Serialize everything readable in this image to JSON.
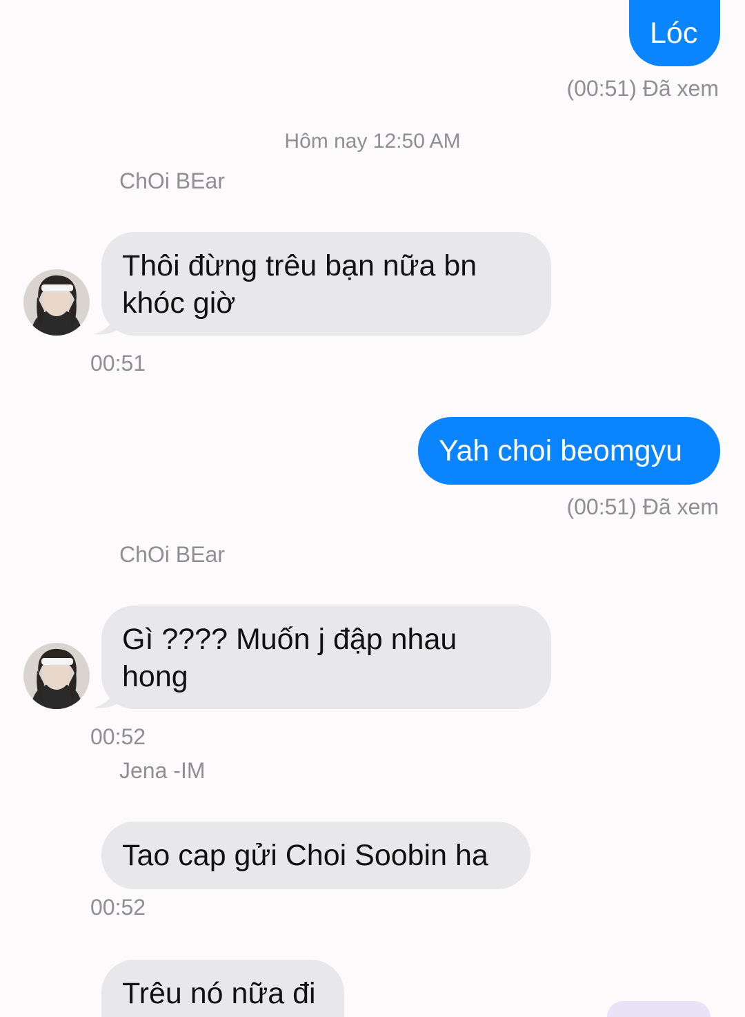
{
  "colors": {
    "outgoing_bubble": "#0a84ff",
    "incoming_bubble": "#e8e8ea",
    "meta_text": "#8e8e93",
    "background": "#fdfafc"
  },
  "messages": {
    "m1": {
      "text": "Lóc",
      "status": "(00:51) Đã xem"
    },
    "divider": {
      "text": "Hôm nay 12:50 AM"
    },
    "m2": {
      "sender": "ChOi BEar",
      "text": "Thôi đừng trêu bạn nữa bn\nkhóc giờ",
      "time": "00:51"
    },
    "m3": {
      "text": "Yah choi beomgyu",
      "status": "(00:51) Đã xem"
    },
    "m4": {
      "sender": "ChOi BEar",
      "text": "Gì ???? Muốn j đập nhau\nhong",
      "time": "00:52"
    },
    "m5": {
      "sender": "Jena -IM",
      "text": "Tao cap gửi Choi Soobin ha",
      "time": "00:52"
    },
    "m6": {
      "text": "Trêu nó nữa đi"
    }
  },
  "icons": {
    "avatar": "avatar-photo"
  }
}
